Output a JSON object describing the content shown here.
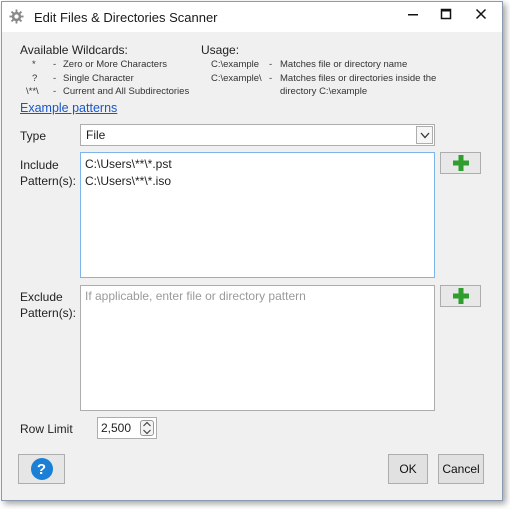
{
  "window": {
    "title": "Edit Files & Directories Scanner",
    "icon": "gear-icon"
  },
  "wildcards": {
    "heading": "Available Wildcards:",
    "items": [
      {
        "symbol": "*",
        "dash": "-",
        "desc": "Zero or More Characters"
      },
      {
        "symbol": "?",
        "dash": "-",
        "desc": "Single Character"
      },
      {
        "symbol": "\\**\\",
        "dash": "-",
        "desc": "Current and All Subdirectories"
      }
    ]
  },
  "usage": {
    "heading": "Usage:",
    "items": [
      {
        "path": "C:\\example",
        "dash": "-",
        "desc": "Matches file or directory name"
      },
      {
        "path": "C:\\example\\",
        "dash": "-",
        "desc": "Matches files or directories inside the"
      },
      {
        "path": "",
        "dash": "",
        "desc": "directory C:\\example"
      }
    ]
  },
  "example_link": "Example patterns",
  "type": {
    "label": "Type",
    "value": "File"
  },
  "include": {
    "label_line1": "Include",
    "label_line2": "Pattern(s):",
    "lines": [
      "C:\\Users\\**\\*.pst",
      "C:\\Users\\**\\*.iso"
    ]
  },
  "exclude": {
    "label_line1": "Exclude",
    "label_line2": "Pattern(s):",
    "placeholder": "If applicable, enter file or directory pattern"
  },
  "row_limit": {
    "label": "Row Limit",
    "value": "2,500"
  },
  "buttons": {
    "ok": "OK",
    "cancel": "Cancel",
    "help": "?"
  },
  "colors": {
    "plus_green": "#2e9e2e",
    "help_blue": "#1c7fd6",
    "link_blue": "#1a56c8"
  }
}
